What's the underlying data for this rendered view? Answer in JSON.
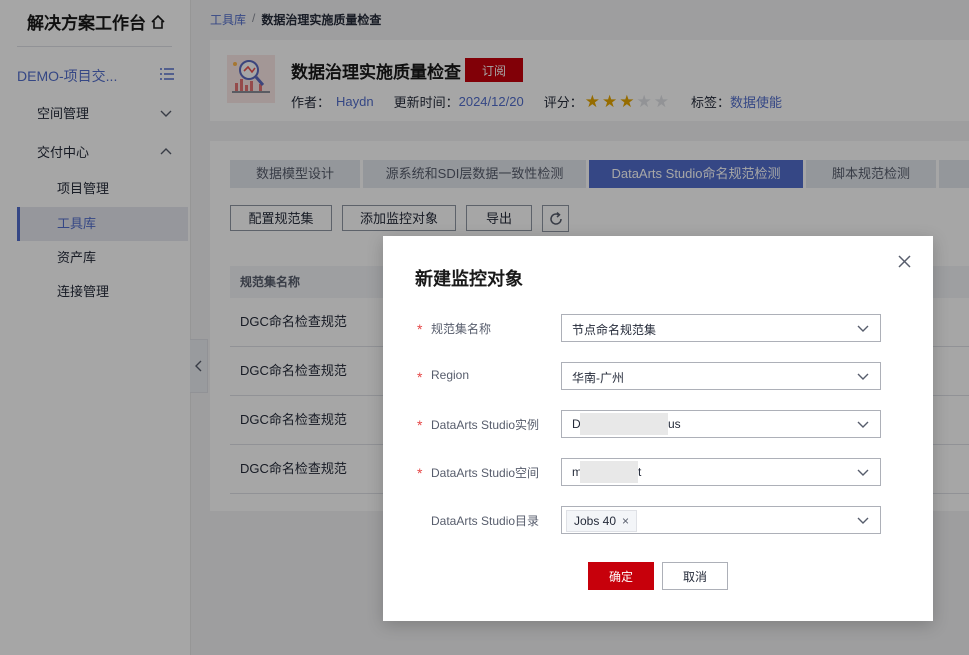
{
  "sidebar": {
    "workbench_title": "解决方案工作台",
    "project_name": "DEMO-项目交...",
    "groups": [
      {
        "label": "空间管理"
      },
      {
        "label": "交付中心"
      }
    ],
    "sub_items": [
      {
        "label": "项目管理"
      },
      {
        "label": "工具库"
      },
      {
        "label": "资产库"
      },
      {
        "label": "连接管理"
      }
    ]
  },
  "breadcrumb": {
    "parent": "工具库",
    "separator": "/",
    "current": "数据治理实施质量检查"
  },
  "header": {
    "title": "数据治理实施质量检查",
    "subscribe_label": "订阅",
    "author_label": "作者：",
    "author": "Haydn",
    "updated_label": "更新时间：",
    "updated": "2024/12/20",
    "rating_label": "评分：",
    "rating": 3,
    "rating_max": 5,
    "tags_label": "标签：",
    "tag": "数据使能"
  },
  "tabs": [
    {
      "label": "数据模型设计"
    },
    {
      "label": "源系统和SDI层数据一致性检测"
    },
    {
      "label": "DataArts Studio命名规范检测"
    },
    {
      "label": "脚本规范检测"
    }
  ],
  "toolbar": {
    "config_label": "配置规范集",
    "add_label": "添加监控对象",
    "export_label": "导出"
  },
  "table": {
    "header": "规范集名称",
    "rows": [
      "DGC命名检查规范",
      "DGC命名检查规范",
      "DGC命名检查规范",
      "DGC命名检查规范"
    ]
  },
  "dialog": {
    "title": "新建监控对象",
    "fields": [
      {
        "label": "规范集名称",
        "value": "节点命名规范集"
      },
      {
        "label": "Region",
        "value": "华南-广州"
      },
      {
        "label": "DataArts Studio实例",
        "value_start": "D",
        "value_end": "us"
      },
      {
        "label": "DataArts Studio空间",
        "value_start": "m",
        "value_end": "t"
      },
      {
        "label": "DataArts Studio目录",
        "tag": "Jobs 40",
        "tag_remove": "×"
      }
    ],
    "required_mark": "*",
    "ok_label": "确定",
    "cancel_label": "取消"
  },
  "colors": {
    "brand_red": "#c7000b",
    "accent_blue": "#526ecc",
    "star_on": "#e6a700",
    "star_off": "#e0e2e6"
  }
}
